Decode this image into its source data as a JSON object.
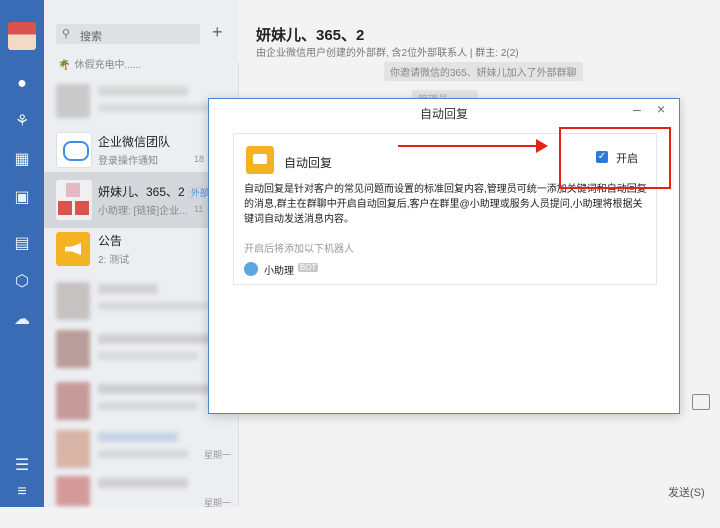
{
  "search": {
    "placeholder": "搜索",
    "search_icon": "search-icon"
  },
  "status": {
    "text": "休假充电中......"
  },
  "conversations": [
    {
      "title": "企业微信团队",
      "subtitle": "登录操作通知",
      "time": "18"
    },
    {
      "title": "妍妹儿、365、2",
      "tag": "外部",
      "subtitle": "小助理: [链接]企业...",
      "time": "11"
    },
    {
      "title": "公告",
      "subtitle": "2: 测试",
      "time": ""
    }
  ],
  "blurred_time_1": "星期一",
  "blurred_time_2": "星期一",
  "chat": {
    "title": "妍妹儿、365、2",
    "subtitle": "由企业微信用户创建的外部群, 含2位外部联系人 | 群主: 2(2)",
    "system_message": "你邀请微信的365、妍妹儿加入了外部群聊",
    "system_message_2": "管理员 ·   ·  ·  ·",
    "send_label": "发送(S)"
  },
  "dialog": {
    "title": "自动回复",
    "card_title": "自动回复",
    "toggle_label": "开启",
    "toggle_checked": true,
    "description": "自动回复是针对客户的常见问题而设置的标准回复内容,管理员可统一添加关键词和自动回复的消息,群主在群聊中开启自动回复后,客户在群里@小助理或服务人员提问,小助理将根据关键词自动发送消息内容。",
    "note": "开启后将添加以下机器人",
    "bot_name": "小助理",
    "bot_badge": "BOT"
  },
  "colors": {
    "nav": "#3a6cb5",
    "accent": "#2d7ad6",
    "annotation": "#e62117",
    "bot_icon": "#f4b322"
  }
}
